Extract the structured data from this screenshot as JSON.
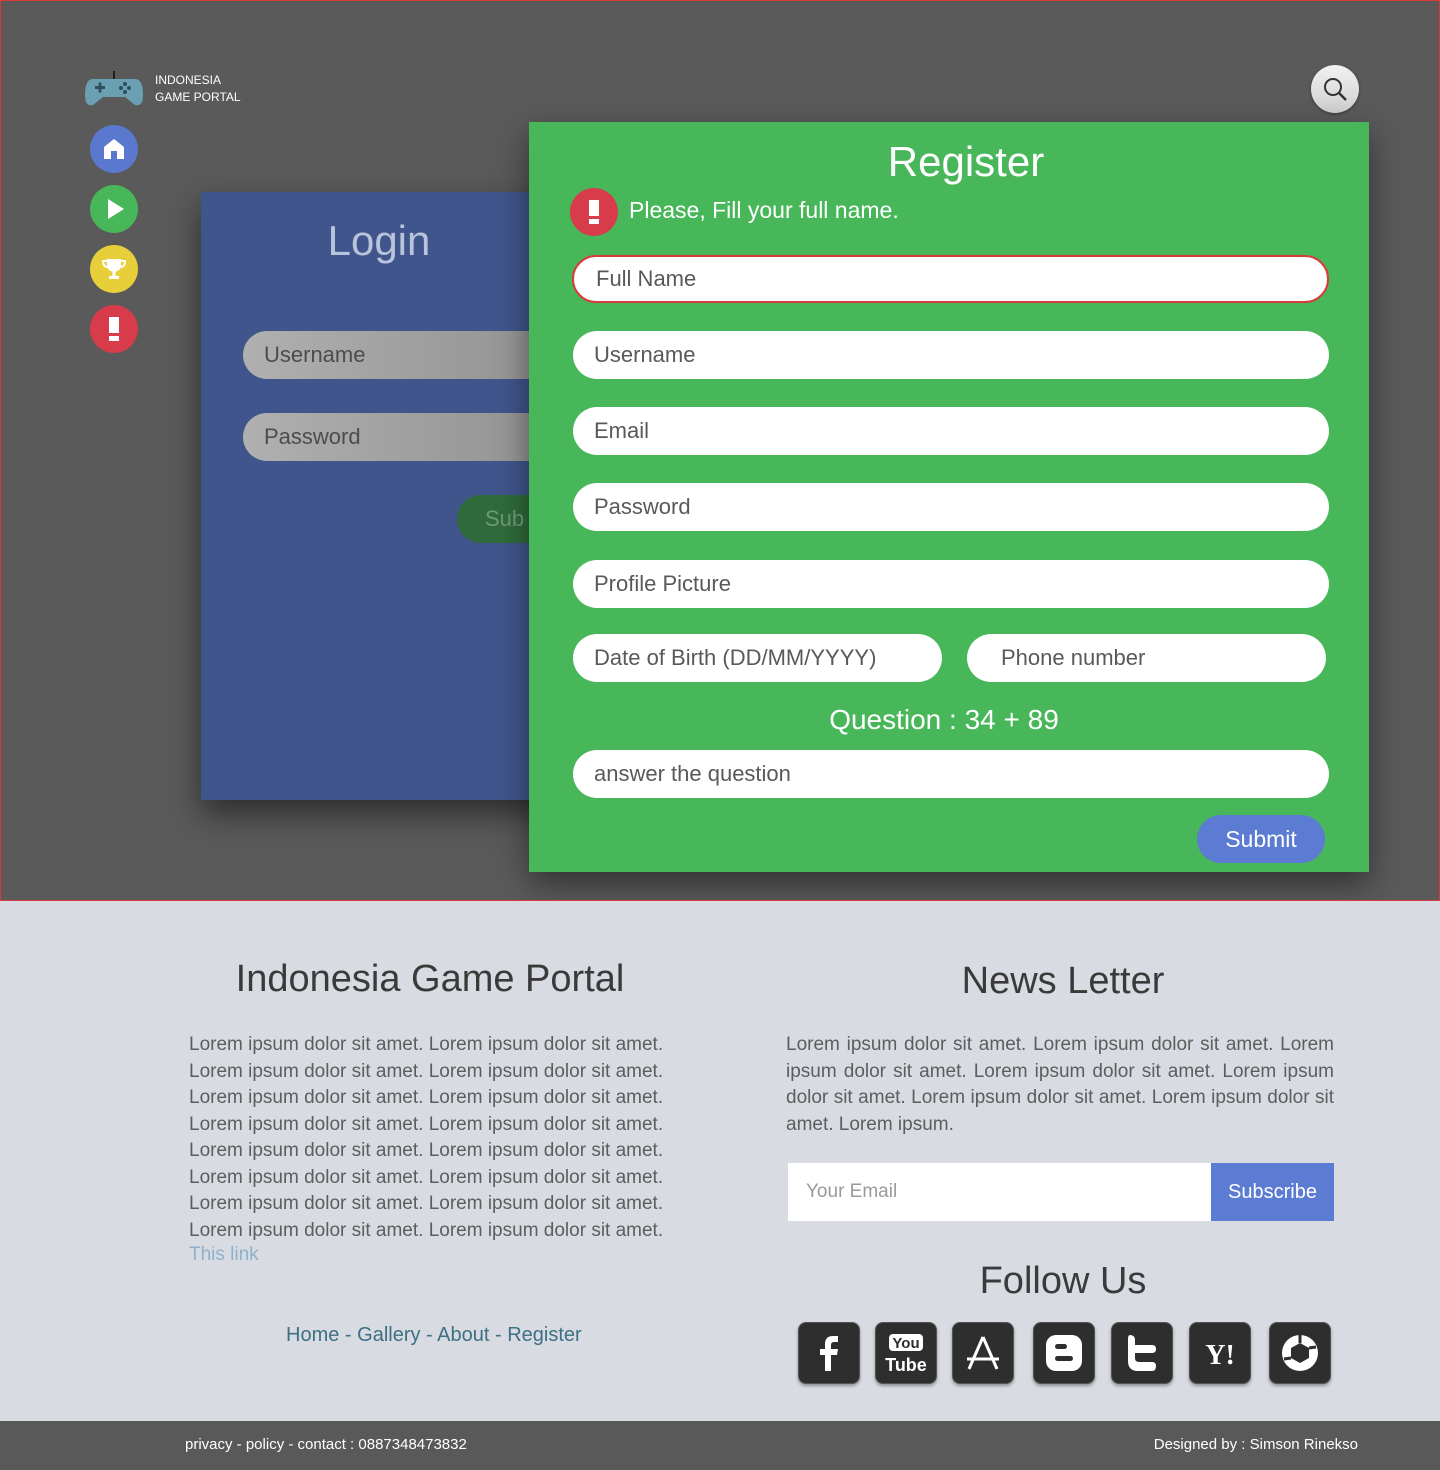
{
  "brand": {
    "line1": "INDONESIA",
    "line2": "GAME PORTAL",
    "icon": "gamepad-icon"
  },
  "sidebar": [
    {
      "name": "home",
      "icon": "home-icon",
      "color": "#5b78cf"
    },
    {
      "name": "play",
      "icon": "play-icon",
      "color": "#48b75a"
    },
    {
      "name": "trophy",
      "icon": "trophy-icon",
      "color": "#e7cf3a"
    },
    {
      "name": "alert",
      "icon": "exclamation-icon",
      "color": "#d83b4a"
    }
  ],
  "search": {
    "icon": "search-icon"
  },
  "login": {
    "title": "Login",
    "username": "Username",
    "password": "Password",
    "submit": "Sub"
  },
  "register": {
    "title": "Register",
    "alert": "Please, Fill your full name.",
    "full_name": "Full Name",
    "username": "Username",
    "email": "Email",
    "password": "Password",
    "profile_picture": "Profile Picture",
    "dob": "Date of Birth  (DD/MM/YYYY)",
    "phone": "Phone number",
    "question": "Question : 34 + 89",
    "answer": "answer the question",
    "submit": "Submit"
  },
  "footer": {
    "about_title": "Indonesia Game Portal",
    "about_lines": [
      "Lorem ipsum dolor sit amet. Lorem ipsum dolor sit amet.",
      "Lorem ipsum dolor sit amet. Lorem ipsum dolor sit amet.",
      "Lorem ipsum dolor sit amet. Lorem ipsum dolor sit amet.",
      "Lorem ipsum dolor sit amet. Lorem ipsum dolor sit amet.",
      "Lorem ipsum dolor sit amet. Lorem ipsum dolor sit amet.",
      "Lorem ipsum dolor sit amet. Lorem ipsum dolor sit amet.",
      "Lorem ipsum dolor sit amet. Lorem ipsum dolor sit amet.",
      "Lorem ipsum dolor sit amet. Lorem ipsum dolor sit amet."
    ],
    "this_link": "This link",
    "links": [
      "Home",
      "Gallery",
      "About",
      "Register"
    ],
    "link_sep": " - ",
    "newsletter_title": "News Letter",
    "newsletter_text": "Lorem ipsum dolor sit amet. Lorem ipsum dolor sit amet. Lorem ipsum dolor sit amet. Lorem ipsum dolor sit amet. Lorem ipsum dolor sit amet. Lorem ipsum dolor sit amet. Lorem ipsum dolor sit amet. Lorem ipsum.",
    "email_placeholder": "Your Email",
    "subscribe": "Subscribe",
    "follow_title": "Follow Us",
    "social": [
      "facebook-icon",
      "youtube-icon",
      "app-store-icon",
      "blogger-icon",
      "twitter-icon",
      "yahoo-icon",
      "picasa-icon"
    ],
    "youtube_text": {
      "you": "You",
      "tube": "Tube"
    },
    "yahoo_text": "Y!"
  },
  "bottom": {
    "left": "privacy - policy - contact : 0887348473832",
    "right": "Designed by : Simson Rinekso"
  }
}
